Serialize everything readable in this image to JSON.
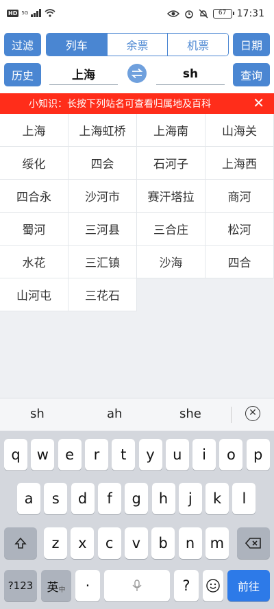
{
  "status": {
    "network": "HD",
    "signal": "5G",
    "battery": "67",
    "time": "17:31"
  },
  "toolbar": {
    "filter": "过滤",
    "tabs": [
      "列车",
      "余票",
      "机票"
    ],
    "date": "日期",
    "history": "历史",
    "from_station": "上海",
    "to_station": "sh",
    "query": "查询"
  },
  "tip": {
    "text": "小知识：长按下列站名可查看归属地及百科",
    "close": "✕"
  },
  "stations": [
    "上海",
    "上海虹桥",
    "上海南",
    "山海关",
    "绥化",
    "四会",
    "石河子",
    "上海西",
    "四合永",
    "沙河市",
    "赛汗塔拉",
    "商河",
    "蜀河",
    "三河县",
    "三合庄",
    "松河",
    "水花",
    "三汇镇",
    "沙海",
    "四合",
    "山河屯",
    "三花石"
  ],
  "suggestions": [
    "sh",
    "ah",
    "she"
  ],
  "keyboard": {
    "row1": [
      "q",
      "w",
      "e",
      "r",
      "t",
      "y",
      "u",
      "i",
      "o",
      "p"
    ],
    "row2": [
      "a",
      "s",
      "d",
      "f",
      "g",
      "h",
      "j",
      "k",
      "l"
    ],
    "row3": [
      "z",
      "x",
      "c",
      "v",
      "b",
      "n",
      "m"
    ],
    "num": "?123",
    "lang": "英",
    "lang_sub": "中",
    "dot": "·",
    "question": "?",
    "enter": "前往"
  }
}
